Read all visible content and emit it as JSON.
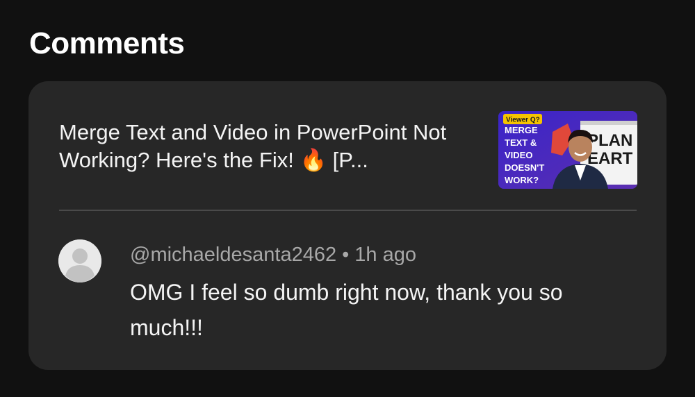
{
  "page": {
    "title": "Comments"
  },
  "video": {
    "title": "Merge Text and Video in PowerPoint Not Working? Here's the Fix! 🔥  [P...",
    "thumbnail": {
      "badge": "Viewer Q?",
      "headline_lines": [
        "MERGE",
        "TEXT &",
        "VIDEO",
        "DOESN'T",
        "WORK?"
      ],
      "slide_text_1": "PLAN",
      "slide_text_2": "EART",
      "colors": {
        "background": "#3b2ab8",
        "badge": "#f5c400",
        "accent": "#e0483a"
      }
    }
  },
  "comment": {
    "author": "@michaeldesanta2462",
    "separator": "•",
    "time": "1h ago",
    "text": "OMG I feel so dumb right now, thank you so much!!!",
    "avatar_icon": "default-user-icon"
  }
}
